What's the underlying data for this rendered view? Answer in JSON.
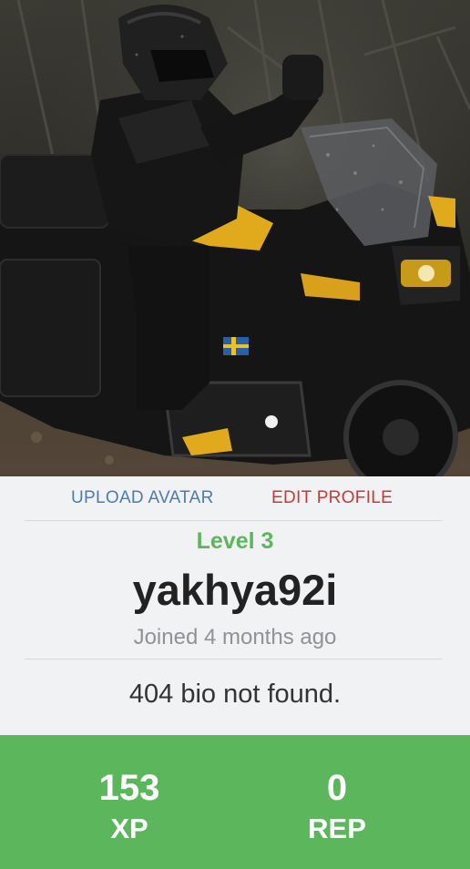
{
  "profile": {
    "avatar": {
      "alt": "",
      "icon": "motorcycle-rider-photo"
    },
    "actions": {
      "upload_avatar": "UPLOAD AVATAR",
      "edit_profile": "EDIT PROFILE"
    },
    "level": "Level 3",
    "username": "yakhya92i",
    "joined": "Joined 4 months ago",
    "bio": "404 bio not found.",
    "stats": {
      "xp": {
        "value": "153",
        "label": "XP"
      },
      "rep": {
        "value": "0",
        "label": "REP"
      }
    }
  },
  "colors": {
    "accent_green": "#5cb65c",
    "upload_blue": "#4a7cb3",
    "edit_red": "#c8393a",
    "background": "#f1f2f3"
  }
}
